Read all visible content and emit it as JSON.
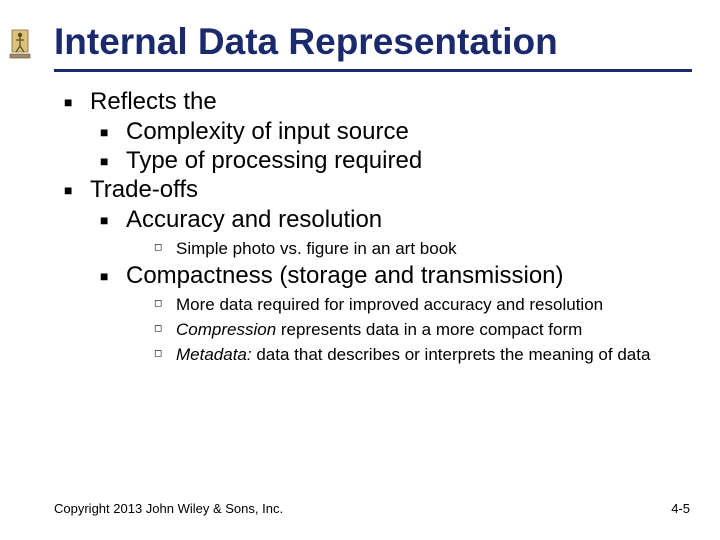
{
  "title": "Internal Data Representation",
  "bullets": {
    "b1": "Reflects the",
    "b1a": "Complexity of input source",
    "b1b": "Type of processing required",
    "b2": "Trade-offs",
    "b2a": "Accuracy and resolution",
    "b2a1": "Simple photo vs. figure in an art book",
    "b2b": "Compactness (storage and transmission)",
    "b2b1": "More data required for improved accuracy and resolution",
    "b2b2_pre": "Compression",
    "b2b2_post": " represents data in a more compact form",
    "b2b3_pre": "Metadata:",
    "b2b3_post": " data that describes or interprets the meaning of data"
  },
  "footer": {
    "copyright": "Copyright 2013 John Wiley & Sons, Inc.",
    "page": "4-5"
  }
}
